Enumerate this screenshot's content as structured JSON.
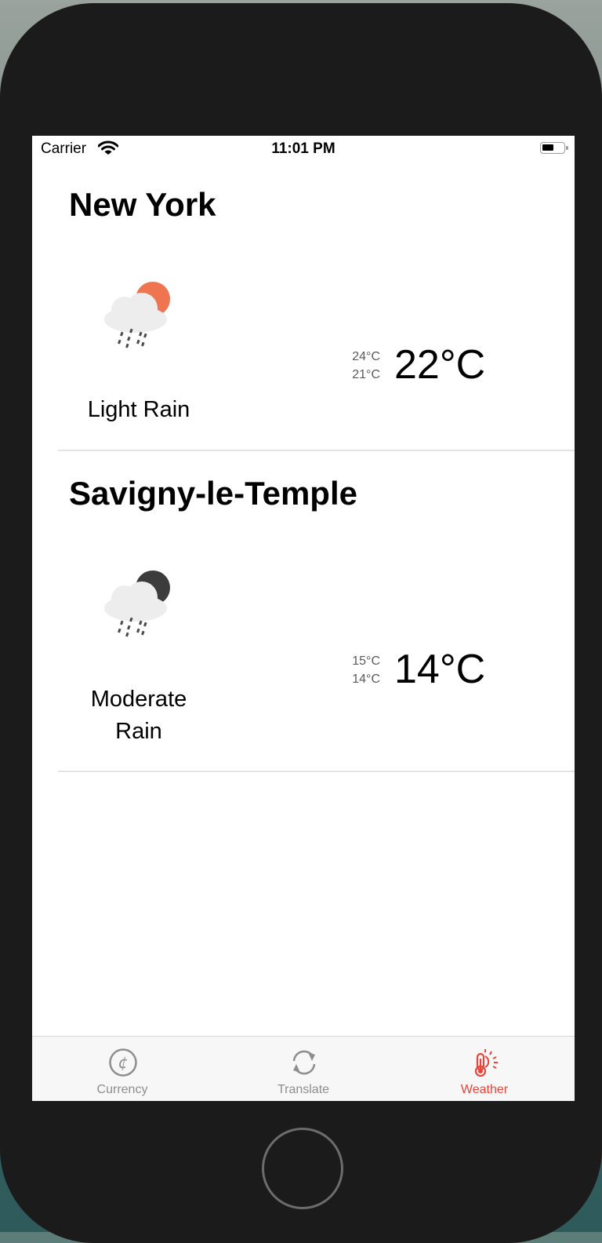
{
  "status_bar": {
    "carrier": "Carrier",
    "time": "11:01 PM"
  },
  "cities": [
    {
      "name": "New York",
      "condition": "Light Rain",
      "icon": "light-rain-day-icon",
      "temp_max": "24°C",
      "temp_min": "21°C",
      "temp_current": "22°C"
    },
    {
      "name": "Savigny-le-Temple",
      "condition": "Moderate Rain",
      "icon": "moderate-rain-night-icon",
      "temp_max": "15°C",
      "temp_min": "14°C",
      "temp_current": "14°C"
    }
  ],
  "tabs": [
    {
      "label": "Currency",
      "icon": "currency-icon",
      "selected": false
    },
    {
      "label": "Translate",
      "icon": "translate-icon",
      "selected": false
    },
    {
      "label": "Weather",
      "icon": "thermometer-sun-icon",
      "selected": true
    }
  ],
  "colors": {
    "accent": "#e8443a",
    "sun": "#ef7550",
    "moon": "#3c3c3c",
    "cloud": "#ededed",
    "tab_inactive": "#8e8e8e"
  }
}
